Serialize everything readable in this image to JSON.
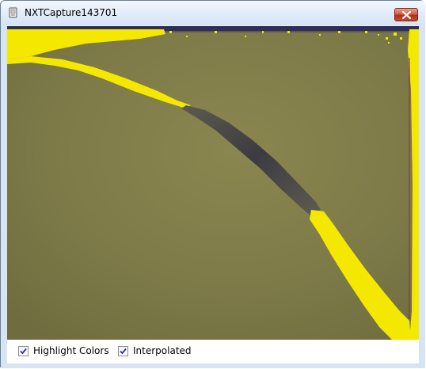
{
  "window": {
    "title": "NXTCapture143701"
  },
  "options": {
    "highlight_colors": {
      "label": "Highlight Colors",
      "checked": true
    },
    "interpolated": {
      "label": "Interpolated",
      "checked": true
    }
  },
  "colors": {
    "highlight": "#f5e800",
    "background": "#7c7947",
    "dark_stripe": "#3f3d40"
  },
  "icons": {
    "title": "app-icon",
    "close": "close-icon",
    "check": "checkmark-icon"
  }
}
